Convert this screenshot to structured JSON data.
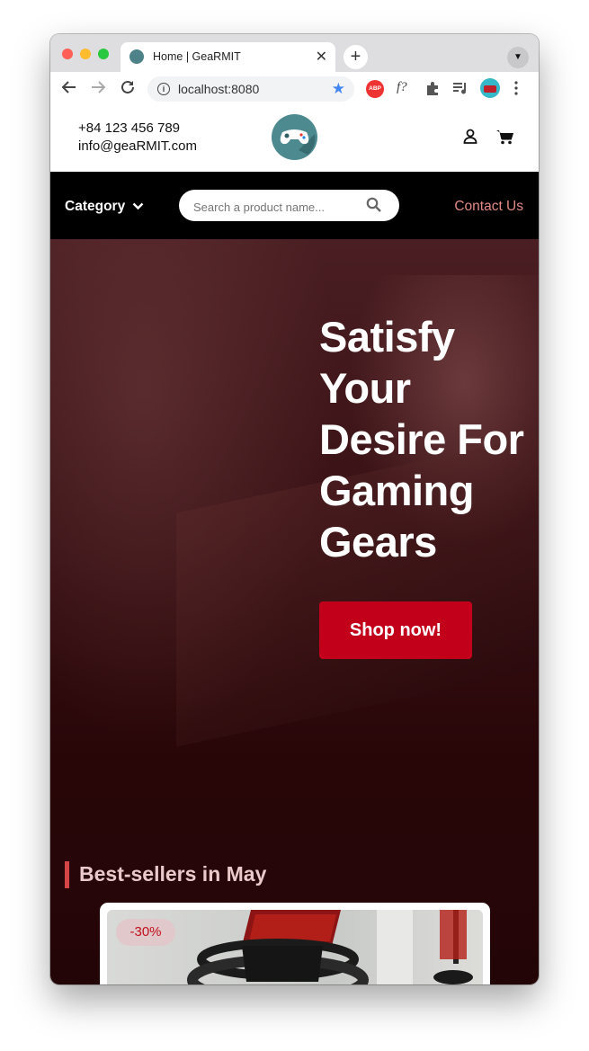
{
  "browser": {
    "tab_title": "Home | GeaRMIT",
    "tab_close": "✕",
    "new_tab": "+",
    "tab_menu": "▼",
    "url": "localhost:8080",
    "extensions": [
      "ABP",
      "f?"
    ]
  },
  "header": {
    "phone": "+84 123 456 789",
    "email": "info@geaRMIT.com"
  },
  "nav": {
    "category_label": "Category",
    "search_placeholder": "Search a product name...",
    "contact_label": "Contact Us"
  },
  "hero": {
    "title_lines": [
      "Satisfy",
      "Your",
      "Desire For",
      "Gaming",
      "Gears"
    ],
    "cta_label": "Shop now!"
  },
  "bestsellers": {
    "title": "Best-sellers in May",
    "products": [
      {
        "discount_badge": "-30%"
      }
    ]
  },
  "colors": {
    "accent": "#c3001a",
    "contact_link": "#e08a86",
    "navbar_bg": "#000000",
    "hero_bg": "#2a070a",
    "logo": "#4d8a90"
  },
  "icons": [
    "back-icon",
    "forward-icon",
    "reload-icon",
    "info-icon",
    "star-icon",
    "puzzle-icon",
    "media-icon",
    "profile-avatar",
    "more-vert-icon",
    "user-icon",
    "cart-icon",
    "chevron-down-icon",
    "search-icon",
    "gamepad-logo"
  ]
}
